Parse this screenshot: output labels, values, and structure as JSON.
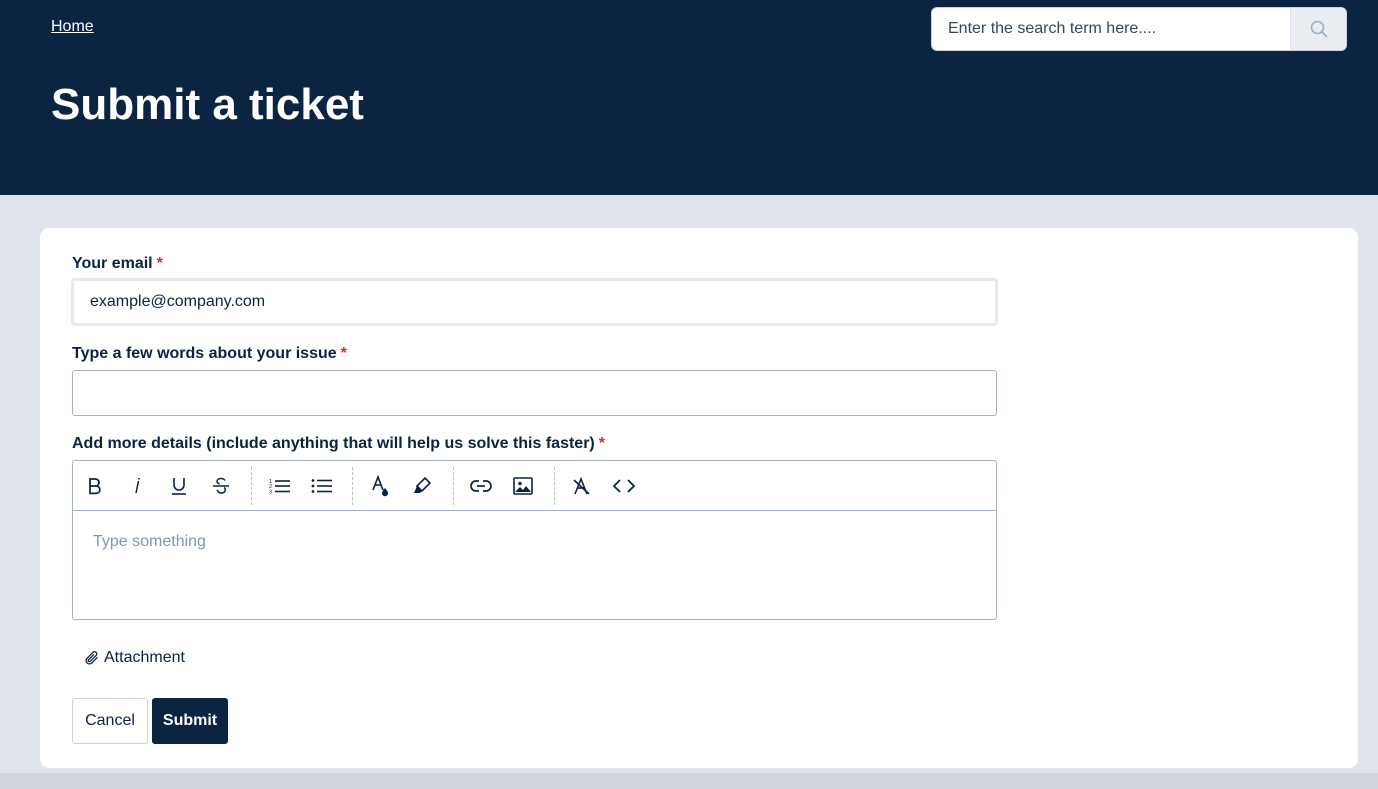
{
  "header": {
    "home_label": "Home",
    "page_title": "Submit a ticket"
  },
  "search": {
    "placeholder": "Enter the search term here....",
    "icon": "search-icon"
  },
  "form": {
    "email": {
      "label": "Your email",
      "required_mark": "*",
      "value": "example@company.com"
    },
    "subject": {
      "label": "Type a few words about your issue",
      "required_mark": "*",
      "value": ""
    },
    "details": {
      "label": "Add more details (include anything that will help us solve this faster)",
      "required_mark": "*",
      "placeholder": "Type something",
      "toolbar": [
        "bold-icon",
        "italic-icon",
        "underline-icon",
        "strikethrough-icon",
        "numbered-list-icon",
        "bulleted-list-icon",
        "text-color-icon",
        "highlight-icon",
        "link-icon",
        "image-icon",
        "clear-formatting-icon",
        "code-icon"
      ]
    },
    "attachment_label": "Attachment",
    "cancel_label": "Cancel",
    "submit_label": "Submit"
  },
  "colors": {
    "header_bg": "#0a2441",
    "page_bg": "#dfe3eb",
    "required": "#d62e28",
    "placeholder": "#7c98b6"
  }
}
